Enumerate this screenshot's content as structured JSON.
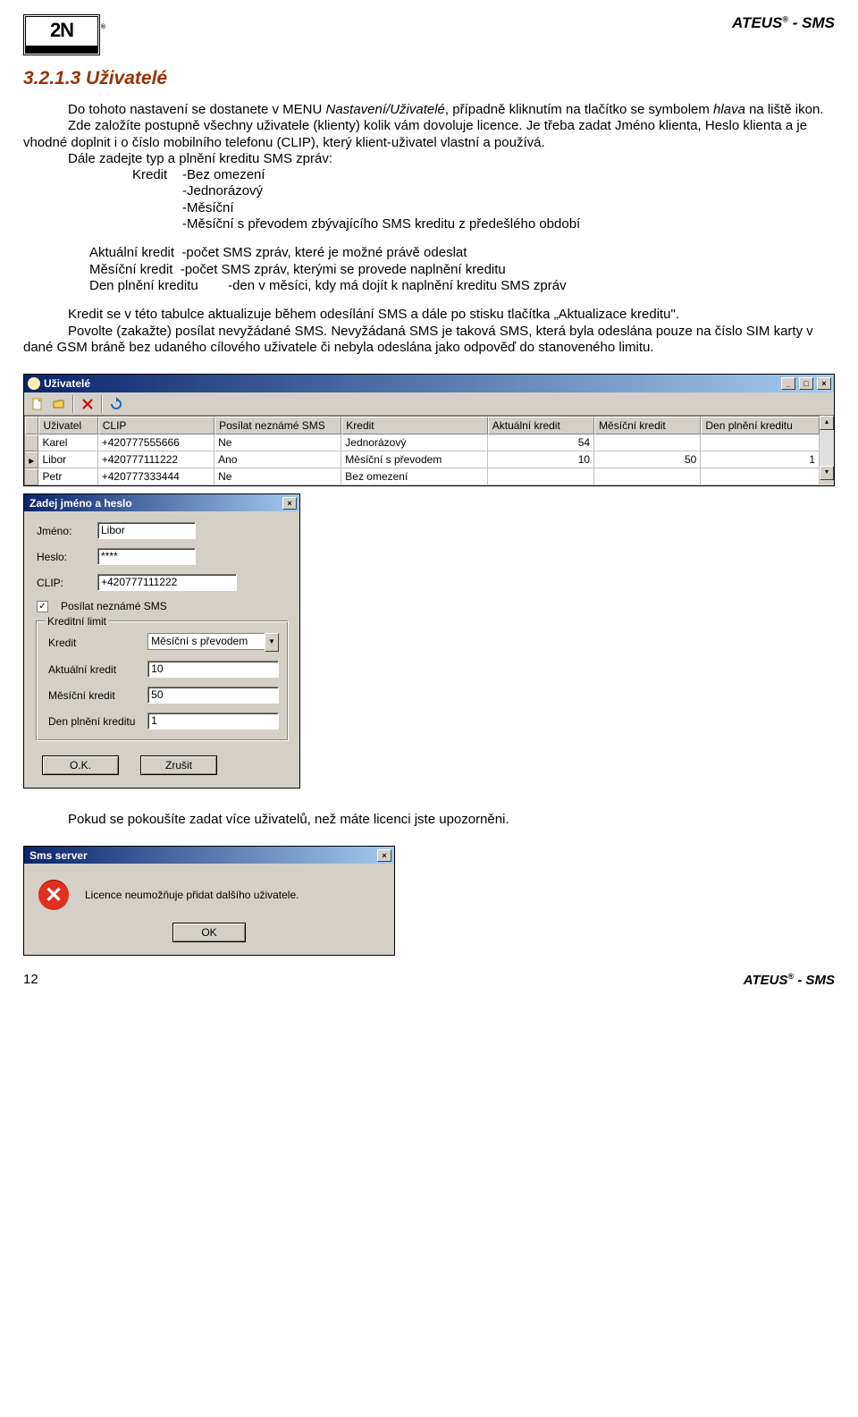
{
  "header": {
    "brand": "2N",
    "brand_reg": "®",
    "right": "ATEUS",
    "right_suffix": " - SMS"
  },
  "section_title": "3.2.1.3 Uživatelé",
  "para1_a": "Do tohoto nastavení se dostanete v MENU ",
  "para1_b": "Nastavení/Uživatelé",
  "para1_c": ", případně kliknutím na tlačítko se symbolem ",
  "para1_d": "hlava",
  "para1_e": " na liště ikon.",
  "para2": "Zde založíte postupně všechny uživatele (klienty) kolik vám dovoluje licence. Je třeba zadat Jméno klienta, Heslo klienta a je vhodné doplnit i o číslo mobilního telefonu (CLIP), který klient-uživatel vlastní a používá.",
  "para3_lead": "Dále zadejte typ a plnění kreditu SMS zpráv:",
  "kredit_label": "Kredit",
  "kredit_opts": [
    "-Bez omezení",
    "-Jednorázový",
    "-Měsíční",
    "-Měsíční s převodem zbývajícího SMS kreditu z předešlého období"
  ],
  "sub_lines": [
    {
      "k": "Aktuální kredit",
      "v": "-počet SMS zpráv, které je možné právě odeslat"
    },
    {
      "k": "Měsíční kredit",
      "v": "-počet SMS zpráv, kterými se provede naplnění kreditu"
    },
    {
      "k": "Den plnění kreditu",
      "v": "-den v měsíci, kdy má dojít k naplnění kreditu SMS zpráv"
    }
  ],
  "para4": "Kredit se v této tabulce aktualizuje během odesílání SMS a dále po stisku tlačítka „Aktualizace kreditu\".",
  "para5": "Povolte (zakažte) posílat nevyžádané SMS. Nevyžádaná SMS je taková SMS, která byla odeslána pouze na číslo SIM karty v dané GSM bráně bez udaného cílového uživatele či nebyla odeslána jako odpověď do stanoveného limitu.",
  "users_window": {
    "title": "Uživatelé",
    "columns": [
      "Uživatel",
      "CLIP",
      "Posílat neznámé SMS",
      "Kredit",
      "Aktuální kredit",
      "Měsíční kredit",
      "Den plnění kreditu"
    ],
    "rows": [
      {
        "u": "Karel",
        "clip": "+420777555666",
        "send": "Ne",
        "kredit": "Jednorázový",
        "ak": "54",
        "mk": "",
        "den": ""
      },
      {
        "u": "Libor",
        "clip": "+420777111222",
        "send": "Ano",
        "kredit": "Měsíční s převodem",
        "ak": "10",
        "mk": "50",
        "den": "1"
      },
      {
        "u": "Petr",
        "clip": "+420777333444",
        "send": "Ne",
        "kredit": "Bez omezení",
        "ak": "",
        "mk": "",
        "den": ""
      }
    ]
  },
  "dialog_userpass": {
    "title": "Zadej jméno a heslo",
    "lbl_name": "Jméno:",
    "val_name": "Libor",
    "lbl_pass": "Heslo:",
    "val_pass": "****",
    "lbl_clip": "CLIP:",
    "val_clip": "+420777111222",
    "chk_label": "Posílat neznámé SMS",
    "legend": "Kreditní limit",
    "lbl_kredit": "Kredit",
    "val_kredit": "Měsíční s převodem",
    "lbl_ak": "Aktuální kredit",
    "val_ak": "10",
    "lbl_mk": "Měsíční kredit",
    "val_mk": "50",
    "lbl_den": "Den plnění kreditu",
    "val_den": "1",
    "btn_ok": "O.K.",
    "btn_cancel": "Zrušit"
  },
  "after_dialog": "Pokud se pokoušíte zadat více uživatelů, než máte licenci jste upozorněni.",
  "sms_dialog": {
    "title": "Sms server",
    "msg": "Licence neumožňuje přidat dalšího uživatele.",
    "btn_ok": "OK"
  },
  "footer": {
    "page": "12",
    "right_a": "ATEUS",
    "right_b": " - SMS"
  }
}
